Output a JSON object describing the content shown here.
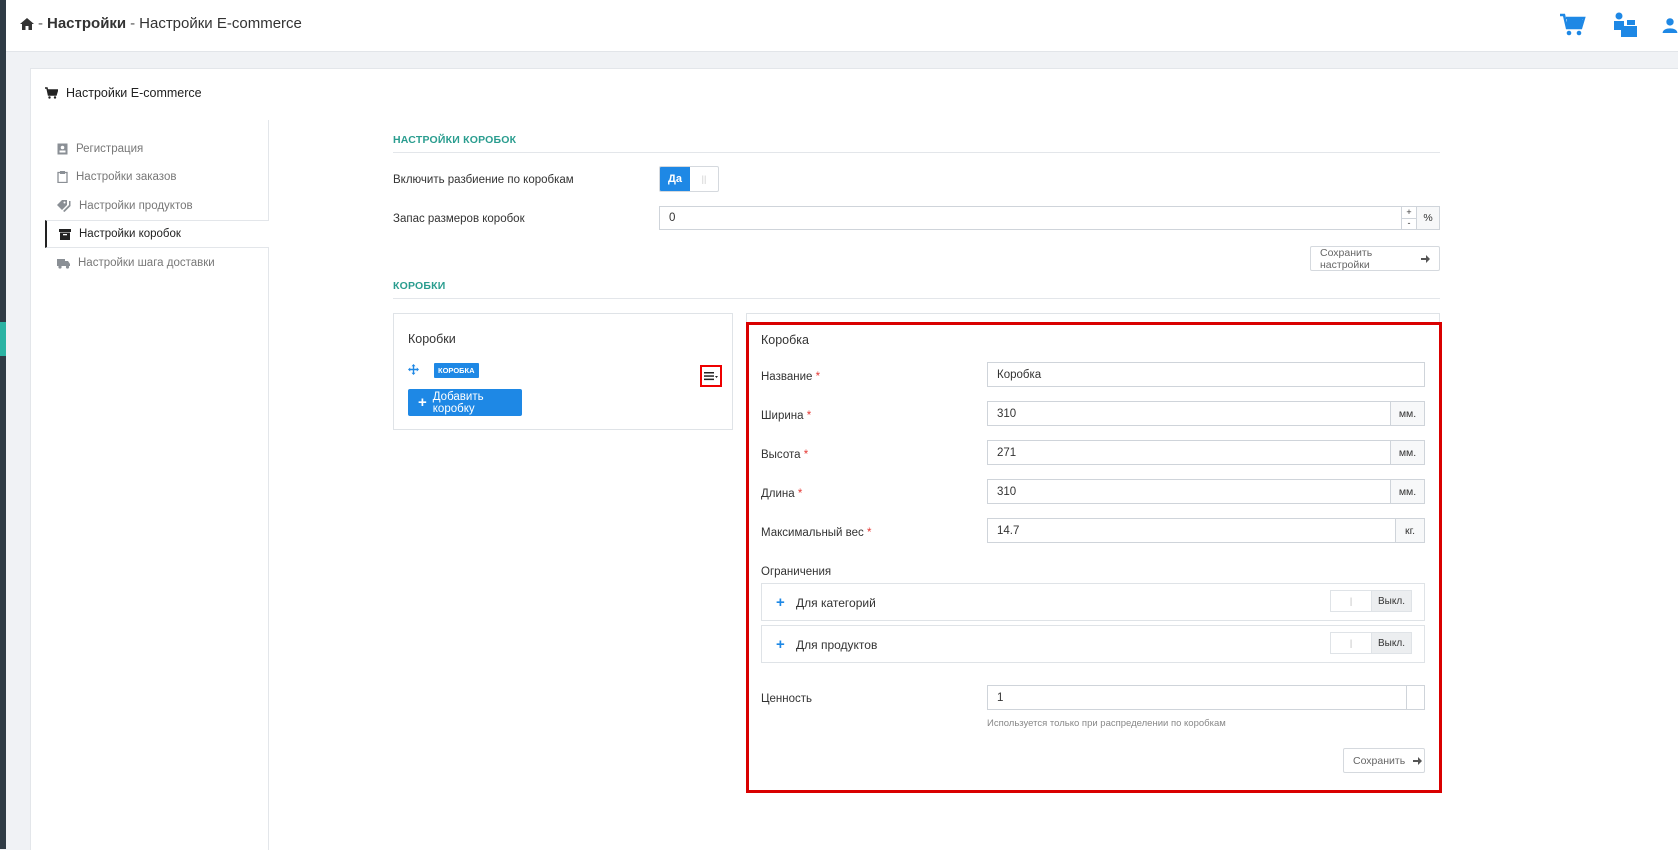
{
  "breadcrumb": {
    "separator": "-",
    "parent": "Настройки",
    "current": "Настройки E-commerce"
  },
  "header_icons": [
    "cart-icon",
    "cashier-icon",
    "user-icon"
  ],
  "panel": {
    "title": "Настройки E-commerce"
  },
  "sidebar": {
    "items": [
      {
        "label": "Регистрация",
        "icon": "contact-card-icon",
        "active": false
      },
      {
        "label": "Настройки заказов",
        "icon": "clipboard-icon",
        "active": false
      },
      {
        "label": "Настройки продуктов",
        "icon": "tags-icon",
        "active": false
      },
      {
        "label": "Настройки коробок",
        "icon": "archive-box-icon",
        "active": true
      },
      {
        "label": "Настройки шага доставки",
        "icon": "truck-icon",
        "active": false
      }
    ]
  },
  "box_settings": {
    "section_title": "НАСТРОЙКИ КОРОБОК",
    "enable_label": "Включить разбиение по коробкам",
    "enable_on_label": "Да",
    "enable_off_label": "||",
    "reserve_label": "Запас размеров коробок",
    "reserve_value": "0",
    "spin_plus": "+",
    "spin_minus": "-",
    "reserve_unit": "%",
    "save_label": "Сохранить настройки"
  },
  "boxes": {
    "section_title": "КОРОБКИ",
    "list_title": "Коробки",
    "item_tag": "КОРОБКА",
    "add_label": "Добавить коробку"
  },
  "box_form": {
    "title": "Коробка",
    "name_label": "Название",
    "name_value": "Коробка",
    "width_label": "Ширина",
    "width_value": "310",
    "width_unit": "мм.",
    "height_label": "Высота",
    "height_value": "271",
    "height_unit": "мм.",
    "length_label": "Длина",
    "length_value": "310",
    "length_unit": "мм.",
    "weight_label": "Максимальный вес",
    "weight_value": "14.7",
    "weight_unit": "кг.",
    "required_mark": "*",
    "limits_label": "Ограничения",
    "limits": [
      {
        "label": "Для категорий",
        "toggle_handle": "|",
        "toggle_state": "Выкл."
      },
      {
        "label": "Для продуктов",
        "toggle_handle": "|",
        "toggle_state": "Выкл."
      }
    ],
    "value_label": "Ценность",
    "value_value": "1",
    "value_hint": "Используется только при распределении по коробкам",
    "save_label": "Сохранить"
  },
  "colors": {
    "accent": "#1e88e5",
    "section_title": "#2a9d8f",
    "highlight": "#d90000"
  }
}
